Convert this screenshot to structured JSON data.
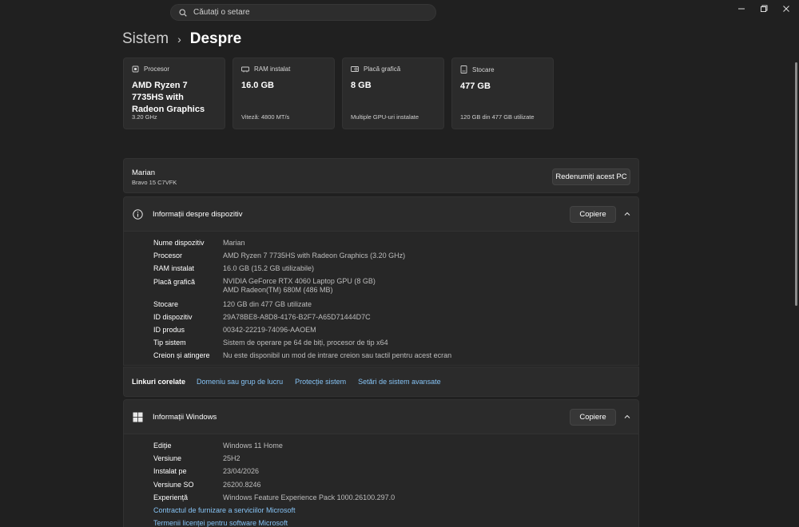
{
  "search": {
    "placeholder": "Căutați o setare"
  },
  "breadcrumb": {
    "parent": "Sistem",
    "current": "Despre"
  },
  "cards": [
    {
      "title": "Procesor",
      "value": "AMD Ryzen 7 7735HS with Radeon Graphics",
      "sub": "3.20 GHz",
      "icon": "processor-icon"
    },
    {
      "title": "RAM instalat",
      "value": "16.0 GB",
      "sub": "Viteză: 4800 MT/s",
      "icon": "ram-icon"
    },
    {
      "title": "Placă grafică",
      "value": "8 GB",
      "sub": "Multiple GPU-uri instalate",
      "icon": "gpu-icon"
    },
    {
      "title": "Stocare",
      "value": "477 GB",
      "sub": "120 GB din 477 GB utilizate",
      "icon": "storage-icon"
    }
  ],
  "pc": {
    "name": "Marian",
    "model": "Bravo 15 C7VFK",
    "rename_label": "Redenumiți acest PC"
  },
  "device_info": {
    "title": "Informații despre dispozitiv",
    "copy_label": "Copiere",
    "rows": [
      {
        "key": "Nume dispozitiv",
        "value": "Marian"
      },
      {
        "key": "Procesor",
        "value": "AMD Ryzen 7 7735HS with Radeon Graphics (3.20 GHz)"
      },
      {
        "key": "RAM instalat",
        "value": "16.0 GB (15.2 GB utilizabile)"
      },
      {
        "key": "Placă grafică",
        "value": "NVIDIA GeForce RTX 4060 Laptop GPU (8 GB)",
        "value2": "AMD Radeon(TM) 680M (486 MB)"
      },
      {
        "key": "Stocare",
        "value": "120 GB din 477 GB utilizate"
      },
      {
        "key": "ID dispozitiv",
        "value": "29A78BE8-A8D8-4176-B2F7-A65D71444D7C"
      },
      {
        "key": "ID produs",
        "value": "00342-22219-74096-AAOEM"
      },
      {
        "key": "Tip sistem",
        "value": "Sistem de operare pe 64 de biți, procesor de tip x64"
      },
      {
        "key": "Creion și atingere",
        "value": "Nu este disponibil un mod de intrare creion sau tactil pentru acest ecran"
      }
    ]
  },
  "related": {
    "label": "Linkuri corelate",
    "links": [
      "Domeniu sau grup de lucru",
      "Protecție sistem",
      "Setări de sistem avansate"
    ]
  },
  "windows_info": {
    "title": "Informații Windows",
    "copy_label": "Copiere",
    "rows": [
      {
        "key": "Ediție",
        "value": "Windows 11 Home"
      },
      {
        "key": "Versiune",
        "value": "25H2"
      },
      {
        "key": "Instalat pe",
        "value": "23/04/2026"
      },
      {
        "key": "Versiune SO",
        "value": "26200.8246"
      },
      {
        "key": "Experiență",
        "value": "Windows Feature Experience Pack 1000.26100.297.0"
      }
    ],
    "links": [
      "Contractul de furnizare a serviciilor Microsoft",
      "Termenii licenței pentru software Microsoft"
    ]
  },
  "colors": {
    "background": "#202020",
    "card": "#2b2b2b",
    "link": "#86c3f5"
  }
}
